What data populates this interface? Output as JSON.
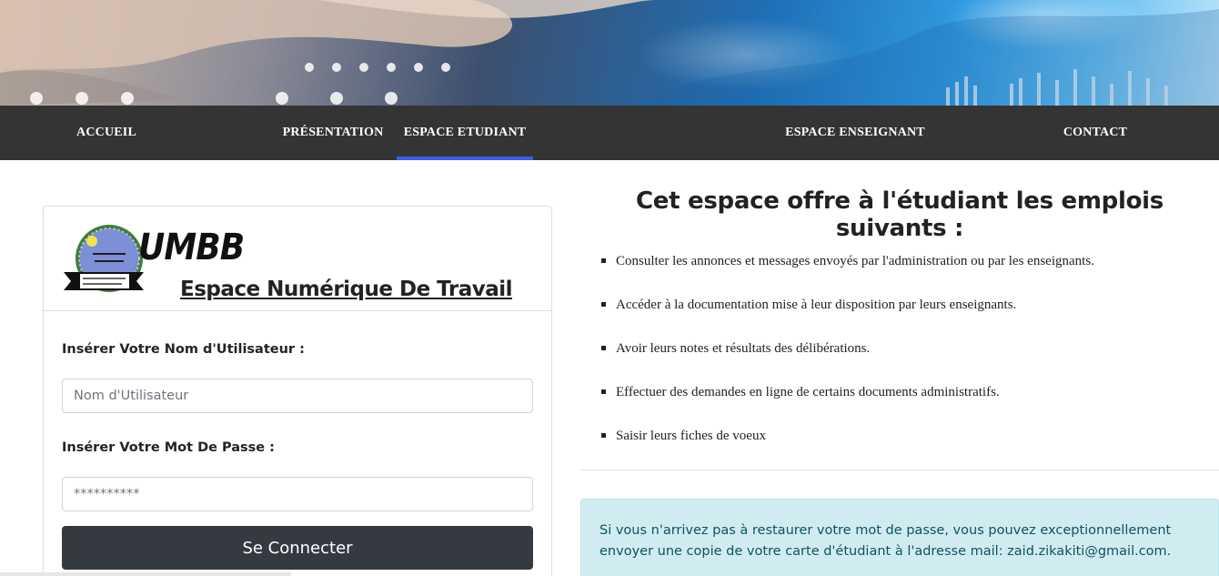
{
  "nav": {
    "items": [
      {
        "label": "ACCUEIL"
      },
      {
        "label": "PRÉSENTATION"
      },
      {
        "label": "ESPACE ETUDIANT"
      },
      {
        "label": "ESPACE ENSEIGNANT"
      },
      {
        "label": "CONTACT"
      }
    ],
    "active": "ESPACE ETUDIANT"
  },
  "login": {
    "logo_text": "UMBB",
    "title": "Espace Numérique De Travail",
    "username_label": "Insérer Votre Nom d'Utilisateur :",
    "username_placeholder": "Nom d'Utilisateur",
    "password_label": "Insérer Votre Mot De Passe :",
    "password_placeholder": "**********",
    "submit_label": "Se Connecter"
  },
  "info": {
    "title": "Cet espace offre à l'étudiant les emplois suivants :",
    "features": [
      "Consulter les annonces et messages envoyés par l'administration ou par les enseignants.",
      "Accéder à la documentation mise à leur disposition par leurs enseignants.",
      "Avoir leurs notes et résultats des délibérations.",
      "Effectuer des demandes en ligne de certains documents administratifs.",
      "Saisir leurs fiches de voeux"
    ],
    "notice": "Si vous n'arrivez pas à restaurer votre mot de passe, vous pouvez exceptionnellement envoyer une copie de votre carte d'étudiant à l'adresse mail: zaid.zikakiti@gmail.com."
  },
  "colors": {
    "nav_bg": "#343434",
    "nav_active": "#3b5de7",
    "button_bg": "#343a40",
    "alert_bg": "#d1ecf1",
    "alert_text": "#0c5460"
  }
}
